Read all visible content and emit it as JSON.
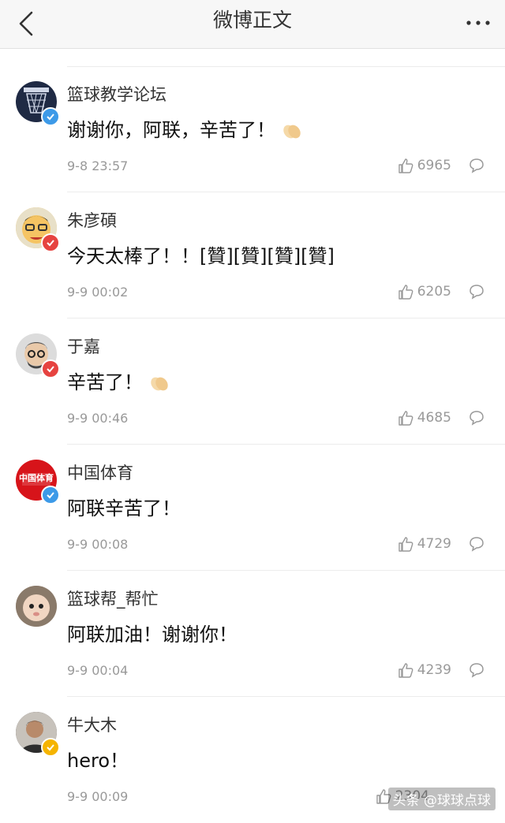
{
  "header": {
    "title": "微博正文",
    "back_icon": "chevron-left-icon",
    "more_icon": "more-dots-icon"
  },
  "comments": [
    {
      "name": "篮球教学论坛",
      "text": "谢谢你，阿联，辛苦了！",
      "emoji": "clap-hands-emoji",
      "time": "9-8 23:57",
      "likes": "6965",
      "avatar_color": "#1f2a44",
      "badge": "blue"
    },
    {
      "name": "朱彦碩",
      "text": "今天太棒了！！[贊][贊][贊][贊]",
      "time": "9-9 00:02",
      "likes": "6205",
      "avatar_color": "#f2c14e",
      "badge": "red"
    },
    {
      "name": "于嘉",
      "text": "辛苦了！",
      "emoji": "clap-hands-emoji",
      "time": "9-9 00:46",
      "likes": "4685",
      "avatar_color": "#7a7a7a",
      "badge": "red"
    },
    {
      "name": "中国体育",
      "text": "阿联辛苦了！",
      "time": "9-9 00:08",
      "likes": "4729",
      "avatar_color": "#d7141a",
      "badge": "blue",
      "avatar_text": "中国体育"
    },
    {
      "name": "篮球帮_帮忙",
      "text": "阿联加油！谢谢你！",
      "time": "9-9 00:04",
      "likes": "4239",
      "avatar_color": "#c9b8a6",
      "badge": "none"
    },
    {
      "name": "牛大木",
      "text": "hero！",
      "time": "9-9 00:09",
      "likes": "2304",
      "avatar_color": "#4a4040",
      "badge": "yellow"
    }
  ],
  "watermark": "头条 @球球点球",
  "colors": {
    "blue_badge": "#3d9ae8",
    "red_badge": "#e64340",
    "yellow_badge": "#f5b400"
  }
}
